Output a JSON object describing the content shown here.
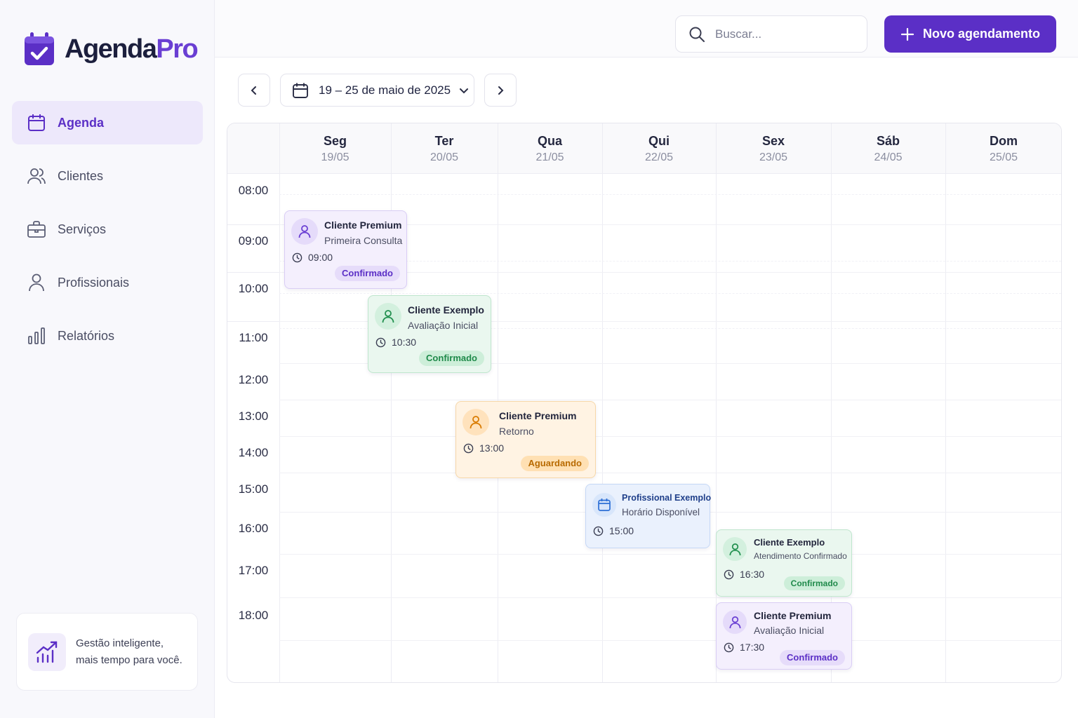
{
  "app": {
    "logo_part1": "Agenda",
    "logo_part2": "Pro",
    "brand_color": "#5b2fc6"
  },
  "sidebar": {
    "items": [
      {
        "label": "Agenda",
        "icon": "calendar-icon",
        "active": true
      },
      {
        "label": "Clientes",
        "icon": "users-icon",
        "active": false
      },
      {
        "label": "Serviços",
        "icon": "briefcase-icon",
        "active": false
      },
      {
        "label": "Profissionais",
        "icon": "user-icon",
        "active": false
      },
      {
        "label": "Relatórios",
        "icon": "bar-chart-icon",
        "active": false
      }
    ],
    "promo": {
      "line1": "Gestão inteligente,",
      "line2": "mais tempo para você.",
      "icon": "chart-growth-icon"
    }
  },
  "topbar": {
    "search_placeholder": "Buscar...",
    "new_button_label": "Novo agendamento"
  },
  "date_nav": {
    "range_label": "19 – 25 de maio de 2025"
  },
  "calendar": {
    "days": [
      {
        "name": "Seg",
        "date": "19/05"
      },
      {
        "name": "Ter",
        "date": "20/05"
      },
      {
        "name": "Qua",
        "date": "21/05"
      },
      {
        "name": "Qui",
        "date": "22/05"
      },
      {
        "name": "Sex",
        "date": "23/05"
      },
      {
        "name": "Sáb",
        "date": "24/05"
      },
      {
        "name": "Dom",
        "date": "25/05"
      }
    ],
    "hours": [
      "08:00",
      "09:00",
      "10:00",
      "11:00",
      "12:00",
      "13:00",
      "14:00",
      "15:00",
      "16:00",
      "17:00",
      "18:00"
    ],
    "events": [
      {
        "name": "Cliente Premium",
        "service": "Primeira Consulta",
        "time": "09:00",
        "status": "Confirmado",
        "color": "purple",
        "icon": "user-icon"
      },
      {
        "name": "Cliente Exemplo",
        "service": "Avaliação Inicial",
        "time": "10:30",
        "status": "Confirmado",
        "color": "green",
        "icon": "user-icon"
      },
      {
        "name": "Cliente Premium",
        "service": "Retorno",
        "time": "13:00",
        "status": "Aguardando",
        "color": "orange",
        "icon": "user-icon"
      },
      {
        "name": "Profissional Exemplo",
        "service": "Horário Disponível",
        "time": "15:00",
        "status": "",
        "color": "blue",
        "icon": "calendar-icon"
      },
      {
        "name": "Cliente Exemplo",
        "service": "Atendimento Confirmado",
        "time": "16:30",
        "status": "Confirmado",
        "color": "green",
        "icon": "user-icon"
      },
      {
        "name": "Cliente Premium",
        "service": "Avaliação Inicial",
        "time": "17:30",
        "status": "Confirmado",
        "color": "purple",
        "icon": "user-icon"
      }
    ]
  }
}
